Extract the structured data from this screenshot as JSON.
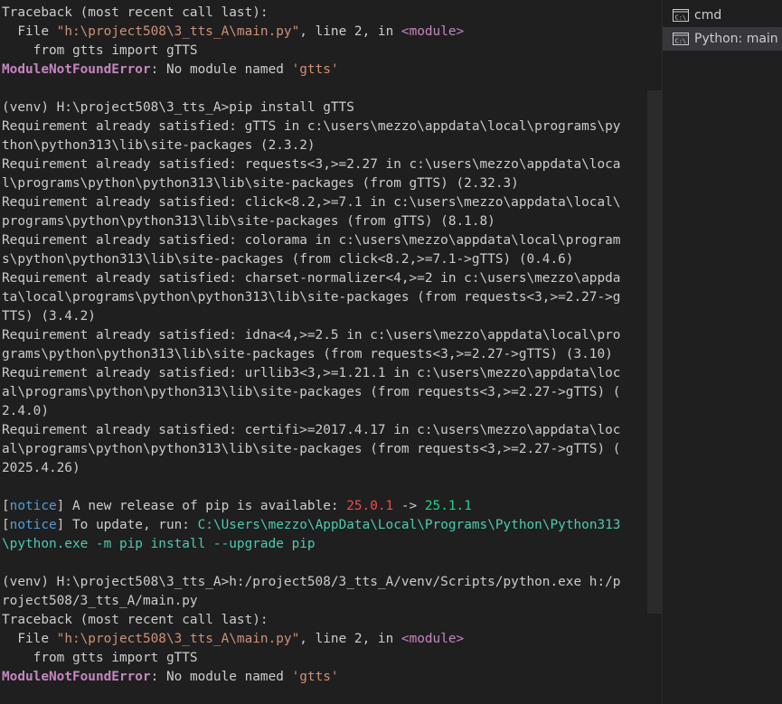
{
  "colors": {
    "background": "#1f1f1f",
    "default": "#cccccc",
    "string": "#ce9178",
    "keyword": "#c586c0",
    "notice": "#569cd6",
    "version_old": "#f14c4c",
    "version_new": "#23d18b",
    "path": "#4ec9b0",
    "tab_active": "#37373d"
  },
  "terminal": {
    "lines": [
      [
        {
          "t": "Traceback (most recent call last):",
          "c": "default"
        }
      ],
      [
        {
          "t": "  File ",
          "c": "default"
        },
        {
          "t": "\"h:\\project508\\3_tts_A\\main.py\"",
          "c": "string"
        },
        {
          "t": ", line ",
          "c": "default"
        },
        {
          "t": "2",
          "c": "default"
        },
        {
          "t": ", in ",
          "c": "default"
        },
        {
          "t": "<module>",
          "c": "keyword"
        }
      ],
      [
        {
          "t": "    from gtts import gTTS",
          "c": "default"
        }
      ],
      [
        {
          "t": "ModuleNotFoundError",
          "c": "keyword",
          "b": true
        },
        {
          "t": ": No module named ",
          "c": "default"
        },
        {
          "t": "'gtts'",
          "c": "string"
        }
      ],
      [
        {
          "t": "",
          "c": "default"
        }
      ],
      [
        {
          "t": "(venv) H:\\project508\\3_tts_A>pip install gTTS",
          "c": "default"
        }
      ],
      [
        {
          "t": "Requirement already satisfied: gTTS in c:\\users\\mezzo\\appdata\\local\\programs\\py",
          "c": "default"
        }
      ],
      [
        {
          "t": "thon\\python313\\lib\\site-packages (2.3.2)",
          "c": "default"
        }
      ],
      [
        {
          "t": "Requirement already satisfied: requests<3,>=2.27 in c:\\users\\mezzo\\appdata\\loca",
          "c": "default"
        }
      ],
      [
        {
          "t": "l\\programs\\python\\python313\\lib\\site-packages (from gTTS) (2.32.3)",
          "c": "default"
        }
      ],
      [
        {
          "t": "Requirement already satisfied: click<8.2,>=7.1 in c:\\users\\mezzo\\appdata\\local\\",
          "c": "default"
        }
      ],
      [
        {
          "t": "programs\\python\\python313\\lib\\site-packages (from gTTS) (8.1.8)",
          "c": "default"
        }
      ],
      [
        {
          "t": "Requirement already satisfied: colorama in c:\\users\\mezzo\\appdata\\local\\program",
          "c": "default"
        }
      ],
      [
        {
          "t": "s\\python\\python313\\lib\\site-packages (from click<8.2,>=7.1->gTTS) (0.4.6)",
          "c": "default"
        }
      ],
      [
        {
          "t": "Requirement already satisfied: charset-normalizer<4,>=2 in c:\\users\\mezzo\\appda",
          "c": "default"
        }
      ],
      [
        {
          "t": "ta\\local\\programs\\python\\python313\\lib\\site-packages (from requests<3,>=2.27->g",
          "c": "default"
        }
      ],
      [
        {
          "t": "TTS) (3.4.2)",
          "c": "default"
        }
      ],
      [
        {
          "t": "Requirement already satisfied: idna<4,>=2.5 in c:\\users\\mezzo\\appdata\\local\\pro",
          "c": "default"
        }
      ],
      [
        {
          "t": "grams\\python\\python313\\lib\\site-packages (from requests<3,>=2.27->gTTS) (3.10)",
          "c": "default"
        }
      ],
      [
        {
          "t": "Requirement already satisfied: urllib3<3,>=1.21.1 in c:\\users\\mezzo\\appdata\\loc",
          "c": "default"
        }
      ],
      [
        {
          "t": "al\\programs\\python\\python313\\lib\\site-packages (from requests<3,>=2.27->gTTS) (",
          "c": "default"
        }
      ],
      [
        {
          "t": "2.4.0)",
          "c": "default"
        }
      ],
      [
        {
          "t": "Requirement already satisfied: certifi>=2017.4.17 in c:\\users\\mezzo\\appdata\\loc",
          "c": "default"
        }
      ],
      [
        {
          "t": "al\\programs\\python\\python313\\lib\\site-packages (from requests<3,>=2.27->gTTS) (",
          "c": "default"
        }
      ],
      [
        {
          "t": "2025.4.26)",
          "c": "default"
        }
      ],
      [
        {
          "t": "",
          "c": "default"
        }
      ],
      [
        {
          "t": "[",
          "c": "default"
        },
        {
          "t": "notice",
          "c": "notice"
        },
        {
          "t": "]",
          "c": "default"
        },
        {
          "t": " A new release of pip is available: ",
          "c": "default"
        },
        {
          "t": "25.0.1",
          "c": "version_old"
        },
        {
          "t": " -> ",
          "c": "default"
        },
        {
          "t": "25.1.1",
          "c": "version_new"
        }
      ],
      [
        {
          "t": "[",
          "c": "default"
        },
        {
          "t": "notice",
          "c": "notice"
        },
        {
          "t": "]",
          "c": "default"
        },
        {
          "t": " To update, run: ",
          "c": "default"
        },
        {
          "t": "C:\\Users\\mezzo\\AppData\\Local\\Programs\\Python\\Python313",
          "c": "path"
        }
      ],
      [
        {
          "t": "\\python.exe -m pip install --upgrade pip",
          "c": "path"
        }
      ],
      [
        {
          "t": "",
          "c": "default"
        }
      ],
      [
        {
          "t": "(venv) H:\\project508\\3_tts_A>h:/project508/3_tts_A/venv/Scripts/python.exe h:/p",
          "c": "default"
        }
      ],
      [
        {
          "t": "roject508/3_tts_A/main.py",
          "c": "default"
        }
      ],
      [
        {
          "t": "Traceback (most recent call last):",
          "c": "default"
        }
      ],
      [
        {
          "t": "  File ",
          "c": "default"
        },
        {
          "t": "\"h:\\project508\\3_tts_A\\main.py\"",
          "c": "string"
        },
        {
          "t": ", line ",
          "c": "default"
        },
        {
          "t": "2",
          "c": "default"
        },
        {
          "t": ", in ",
          "c": "default"
        },
        {
          "t": "<module>",
          "c": "keyword"
        }
      ],
      [
        {
          "t": "    from gtts import gTTS",
          "c": "default"
        }
      ],
      [
        {
          "t": "ModuleNotFoundError",
          "c": "keyword",
          "b": true
        },
        {
          "t": ": No module named ",
          "c": "default"
        },
        {
          "t": "'gtts'",
          "c": "string"
        }
      ]
    ]
  },
  "tabs": [
    {
      "label": "cmd",
      "icon": "terminal-cmd-icon",
      "active": false
    },
    {
      "label": "Python: main",
      "icon": "terminal-python-icon",
      "active": true
    }
  ]
}
